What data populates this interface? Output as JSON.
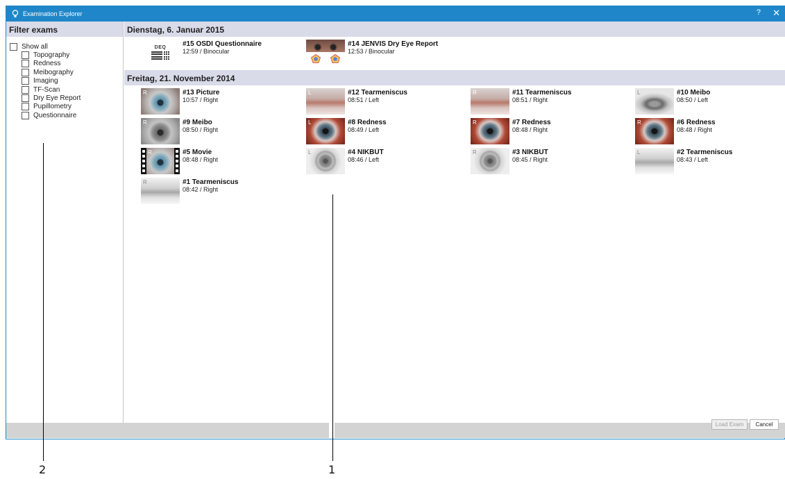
{
  "window": {
    "title": "Examination Explorer",
    "help_label": "?",
    "close_label": "✕"
  },
  "filter": {
    "title": "Filter exams",
    "show_all": "Show all",
    "items": [
      "Topography",
      "Redness",
      "Meibography",
      "Imaging",
      "TF-Scan",
      "Dry Eye Report",
      "Pupillometry",
      "Questionnaire"
    ]
  },
  "groups": [
    {
      "date": "Dienstag, 6. Januar 2015",
      "exams": [
        {
          "name": "#15 OSDI Questionnaire",
          "time": "12:59 / Binocular",
          "thumb": "deq",
          "eye": "",
          "thumb_text": "DEQ"
        },
        {
          "name": "#14 JENVIS Dry Eye Report",
          "time": "12:53 / Binocular",
          "thumb": "report",
          "eye": ""
        }
      ]
    },
    {
      "date": "Freitag, 21. November 2014",
      "exams": [
        {
          "name": "#13 Picture",
          "time": "10:57 / Right",
          "thumb": "color",
          "eye": "R"
        },
        {
          "name": "#12 Tearmeniscus",
          "time": "08:51 / Left",
          "thumb": "tear",
          "eye": "L"
        },
        {
          "name": "#11 Tearmeniscus",
          "time": "08:51 / Right",
          "thumb": "tear",
          "eye": "R"
        },
        {
          "name": "#10 Meibo",
          "time": "08:50 / Left",
          "thumb": "meibo",
          "eye": "L"
        },
        {
          "name": "#9 Meibo",
          "time": "08:50 / Right",
          "thumb": "gray",
          "eye": "R"
        },
        {
          "name": "#8 Redness",
          "time": "08:49 / Left",
          "thumb": "red",
          "eye": "L"
        },
        {
          "name": "#7 Redness",
          "time": "08:48 / Right",
          "thumb": "red",
          "eye": "R"
        },
        {
          "name": "#6 Redness",
          "time": "08:48 / Right",
          "thumb": "red",
          "eye": "R"
        },
        {
          "name": "#5 Movie",
          "time": "08:48 / Right",
          "thumb": "movie",
          "eye": "R"
        },
        {
          "name": "#4 NIKBUT",
          "time": "08:46 / Left",
          "thumb": "nik",
          "eye": "L"
        },
        {
          "name": "#3 NIKBUT",
          "time": "08:45 / Right",
          "thumb": "nik",
          "eye": "R"
        },
        {
          "name": "#2 Tearmeniscus",
          "time": "08:43 / Left",
          "thumb": "tear-gray",
          "eye": "L"
        },
        {
          "name": "#1 Tearmeniscus",
          "time": "08:42 / Right",
          "thumb": "tear-gray",
          "eye": "R"
        }
      ]
    }
  ],
  "buttons": {
    "load_exam": "Load Exam",
    "cancel": "Cancel"
  },
  "callouts": {
    "one": "1",
    "two": "2"
  },
  "colors": {
    "titlebar": "#1f87c9",
    "header_band": "#d9dbe9",
    "status_bar": "#d3d3d3"
  }
}
